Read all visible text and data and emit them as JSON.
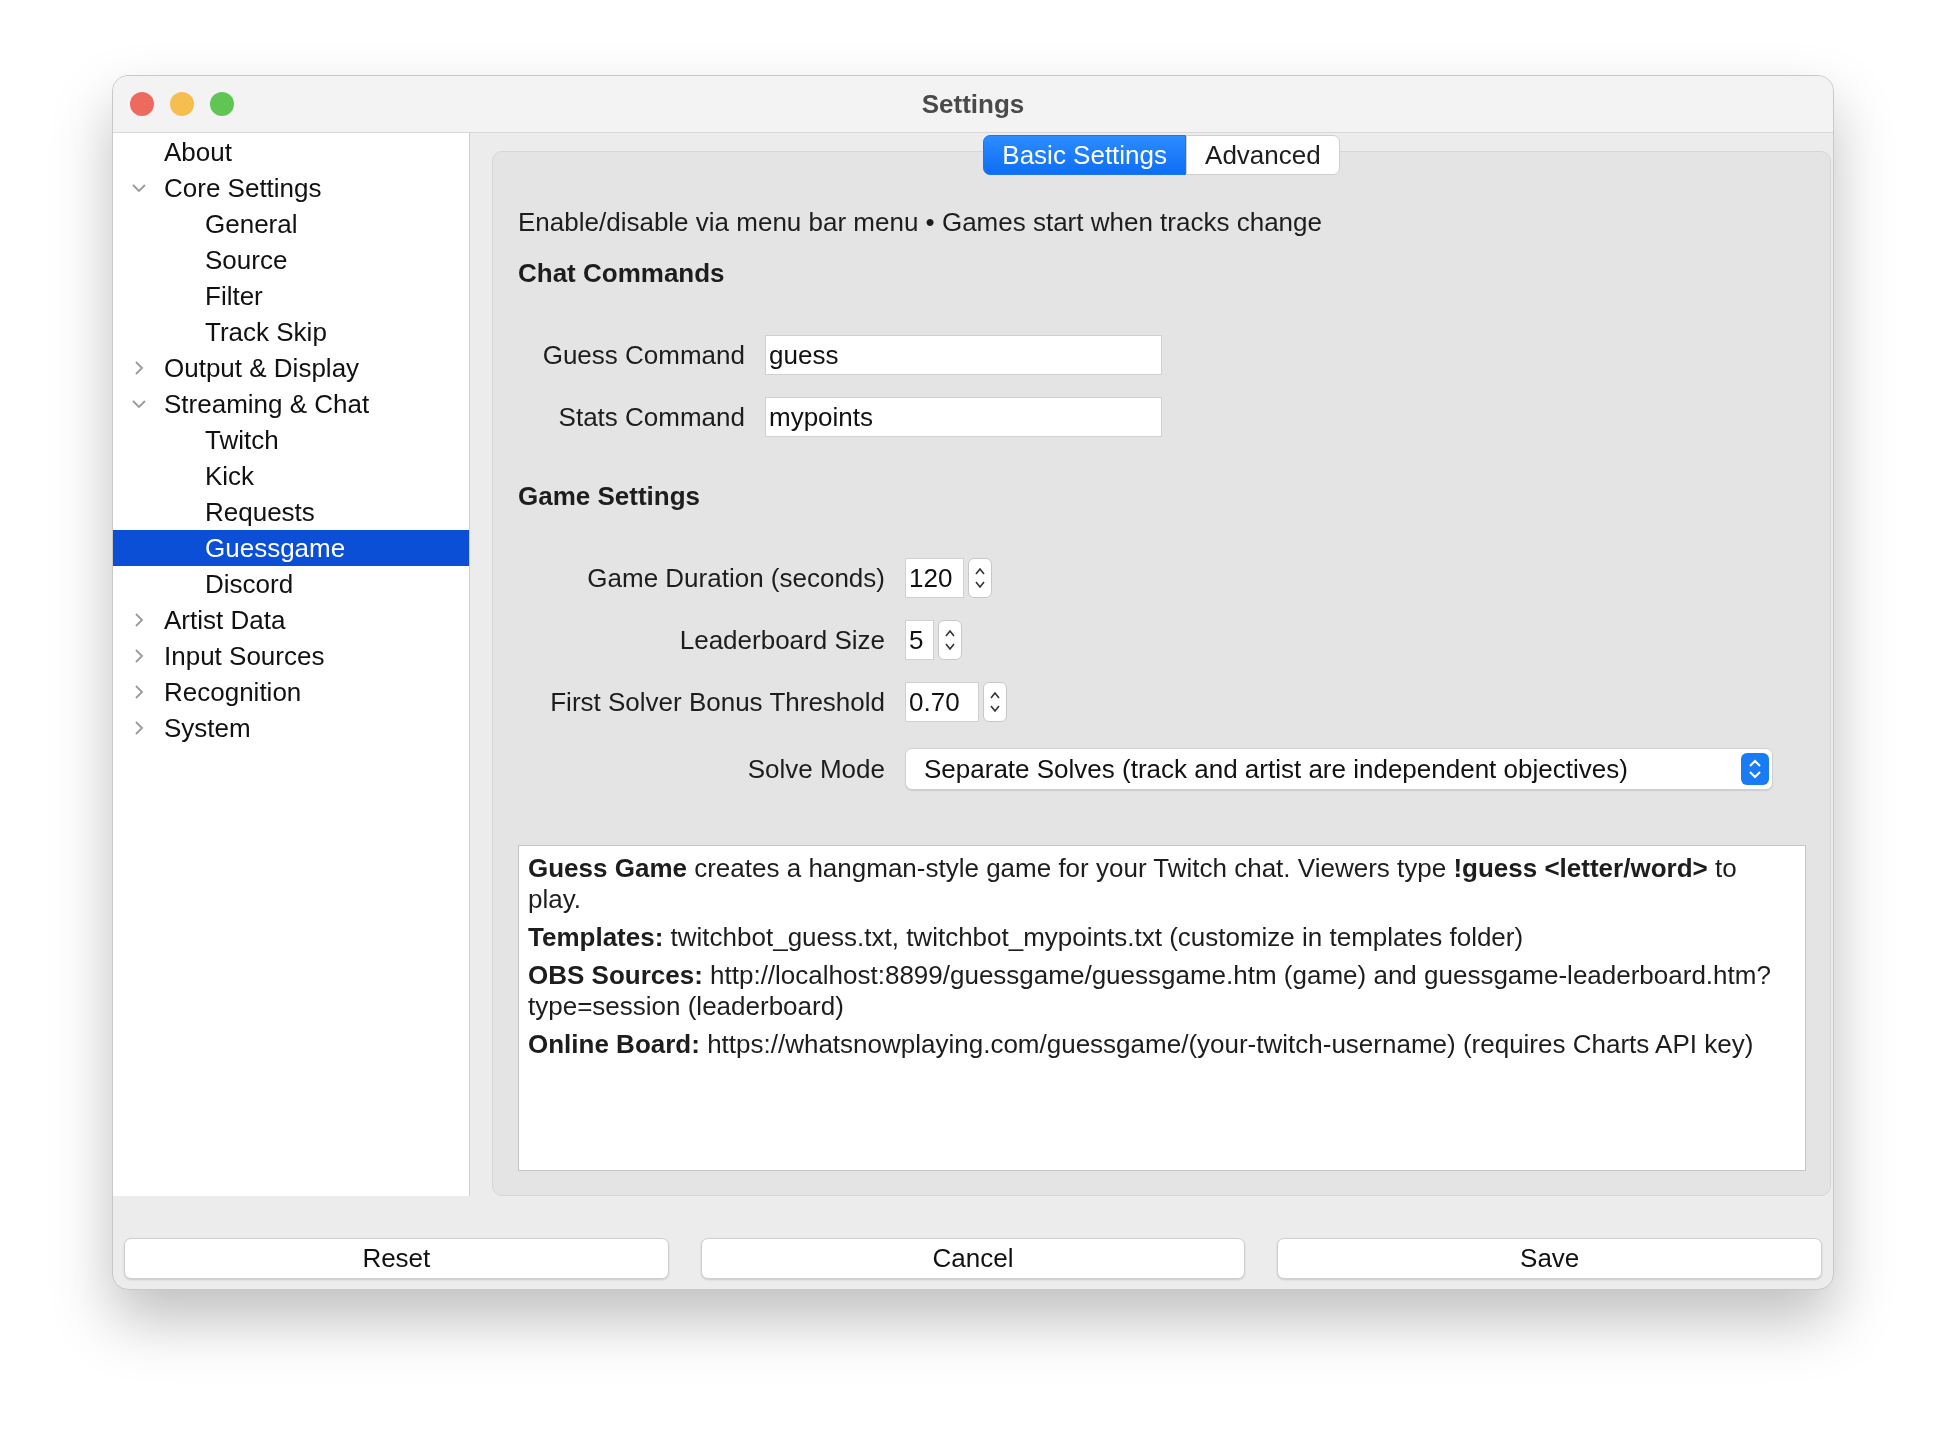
{
  "window": {
    "title": "Settings"
  },
  "sidebar": {
    "items": [
      {
        "label": "About",
        "selected": false
      },
      {
        "label": "Core Settings",
        "selected": false,
        "expanded": true,
        "children": [
          {
            "label": "General",
            "selected": false
          },
          {
            "label": "Source",
            "selected": false
          },
          {
            "label": "Filter",
            "selected": false
          },
          {
            "label": "Track Skip",
            "selected": false
          }
        ]
      },
      {
        "label": "Output & Display",
        "selected": false,
        "expanded": false
      },
      {
        "label": "Streaming & Chat",
        "selected": false,
        "expanded": true,
        "children": [
          {
            "label": "Twitch",
            "selected": false
          },
          {
            "label": "Kick",
            "selected": false
          },
          {
            "label": "Requests",
            "selected": false
          },
          {
            "label": "Guessgame",
            "selected": true
          },
          {
            "label": "Discord",
            "selected": false
          }
        ]
      },
      {
        "label": "Artist Data",
        "selected": false,
        "expanded": false
      },
      {
        "label": "Input Sources",
        "selected": false,
        "expanded": false
      },
      {
        "label": "Recognition",
        "selected": false,
        "expanded": false
      },
      {
        "label": "System",
        "selected": false,
        "expanded": false
      }
    ]
  },
  "tabs": [
    {
      "label": "Basic Settings",
      "selected": true
    },
    {
      "label": "Advanced",
      "selected": false
    }
  ],
  "intro": "Enable/disable via menu bar menu • Games start when tracks change",
  "chat_commands": {
    "heading": "Chat Commands",
    "fields": [
      {
        "label": "Guess Command",
        "value": "guess"
      },
      {
        "label": "Stats Command",
        "value": "mypoints"
      }
    ]
  },
  "game_settings": {
    "heading": "Game Settings",
    "fields": [
      {
        "kind": "spin",
        "label": "Game Duration (seconds)",
        "value": "120"
      },
      {
        "kind": "spin",
        "label": "Leaderboard Size",
        "value": "5"
      },
      {
        "kind": "spin",
        "label": "First Solver Bonus Threshold",
        "value": "0.70"
      },
      {
        "kind": "select",
        "label": "Solve Mode",
        "value": "Separate Solves (track and artist are independent objectives)"
      }
    ]
  },
  "help": [
    "**Guess Game** creates a hangman-style game for your Twitch chat. Viewers type **!guess <letter/word>** to play.",
    "**Templates:** twitchbot_guess.txt, twitchbot_mypoints.txt (customize in templates folder)",
    "**OBS Sources:** http://localhost:8899/guessgame/guessgame.htm (game) and guessgame-leaderboard.htm?type=session (leaderboard)",
    "**Online Board:** https://whatsnowplaying.com/guessgame/(your-twitch-username) (requires Charts API key)"
  ],
  "buttons": [
    "Reset",
    "Cancel",
    "Save"
  ]
}
